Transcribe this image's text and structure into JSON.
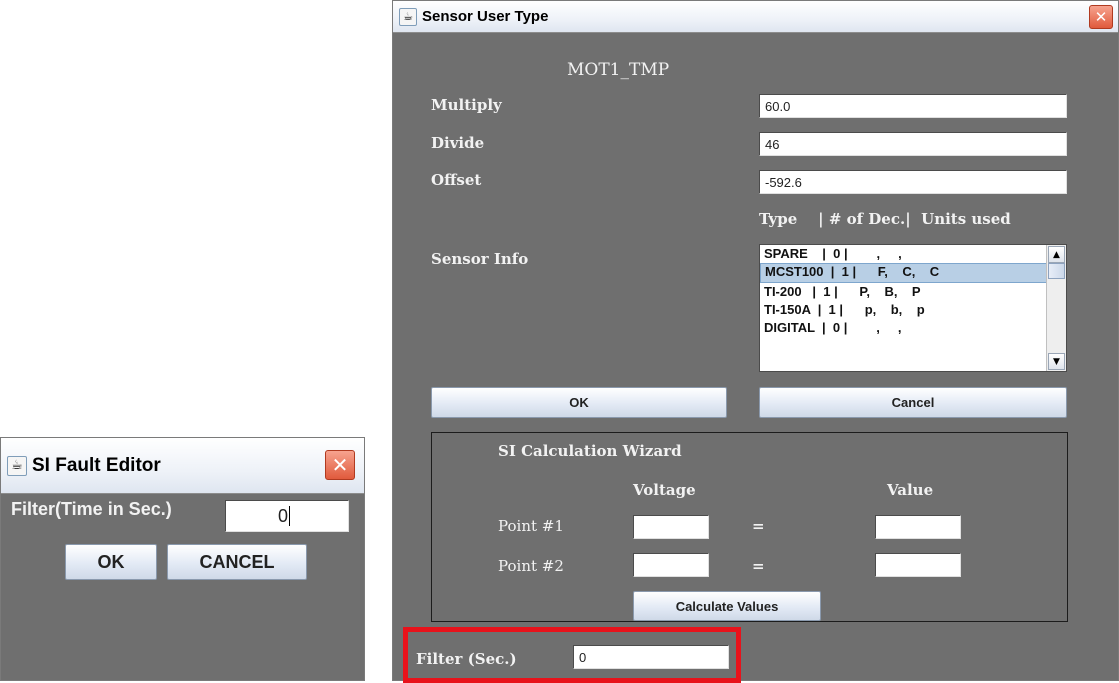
{
  "fault_editor": {
    "title": "SI Fault Editor",
    "filter_label": "Filter(Time in Sec.)",
    "filter_value": "0",
    "ok_label": "OK",
    "cancel_label": "CANCEL"
  },
  "sensor_dialog": {
    "title": "Sensor User Type",
    "sensor_name": "MOT1_TMP",
    "multiply_label": "Multiply",
    "multiply_value": "60.0",
    "divide_label": "Divide",
    "divide_value": "46",
    "offset_label": "Offset",
    "offset_value": "-592.6",
    "column_header": "Type    | # of Dec.|  Units used",
    "sensor_info_label": "Sensor Info",
    "list_items": [
      "SPARE    |  0 |        ,     ,",
      "MCST100  |  1 |      F,    C,    C",
      "TI-200   |  1 |      P,    B,    P",
      "TI-150A  |  1 |      p,    b,    p",
      "DIGITAL  |  0 |        ,     ,"
    ],
    "selected_index": 1,
    "ok_label": "OK",
    "cancel_label": "Cancel",
    "wizard": {
      "title": "SI Calculation Wizard",
      "voltage_header": "Voltage",
      "value_header": "Value",
      "point1_label": "Point #1",
      "point2_label": "Point #2",
      "equals": "=",
      "calculate_label": "Calculate Values"
    },
    "filter_label": "Filter (Sec.)",
    "filter_value": "0"
  },
  "colors": {
    "dialog_bg": "#6f6f6f",
    "highlight": "#e8121b",
    "selected_row": "#b8cfe5"
  }
}
